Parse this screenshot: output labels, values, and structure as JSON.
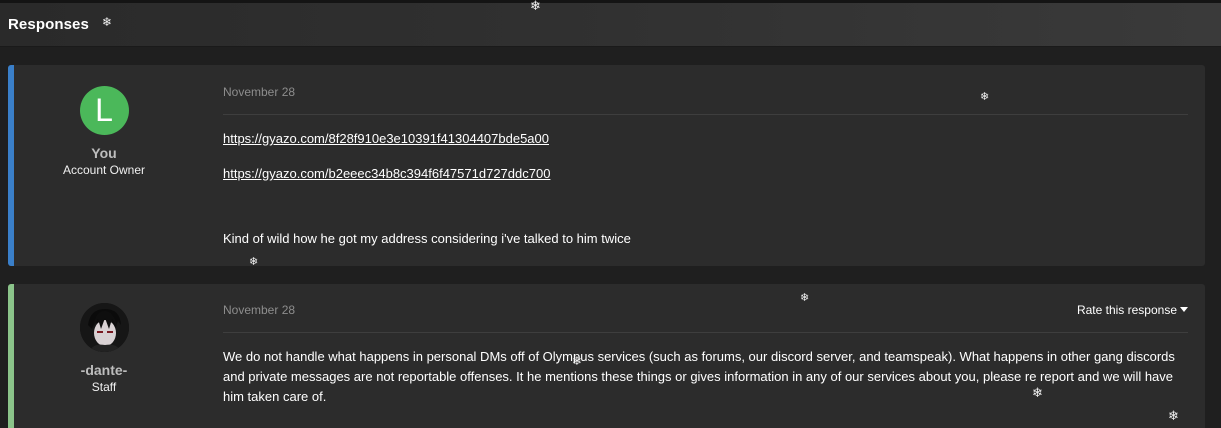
{
  "header": {
    "title": "Responses"
  },
  "responses": [
    {
      "author": {
        "avatar_letter": "L",
        "name": "You",
        "role": "Account Owner"
      },
      "date": "November 28",
      "links": [
        "https://gyazo.com/8f28f910e3e10391f41304407bde5a00",
        "https://gyazo.com/b2eeec34b8c394f6f47571d727ddc700"
      ],
      "text": "Kind of wild how he got my address considering i've talked to him twice"
    },
    {
      "author": {
        "avatar_icon": "anime-avatar-icon",
        "name": "-dante-",
        "role": "Staff"
      },
      "date": "November 28",
      "rate_label": "Rate this response",
      "text": "We do not handle what happens in personal DMs off of Olympus services (such as forums, our discord server, and teamspeak). What happens in other gang discords and private messages are not reportable offenses. It he mentions these things or gives information in any of our services about you, please re report and we will have him taken care of."
    }
  ],
  "icons": {
    "snowflake": "snowflake-icon"
  },
  "colors": {
    "accent_owner": "#3a7fc9",
    "accent_staff": "#8bc48a",
    "avatar_green": "#4bb85a"
  }
}
